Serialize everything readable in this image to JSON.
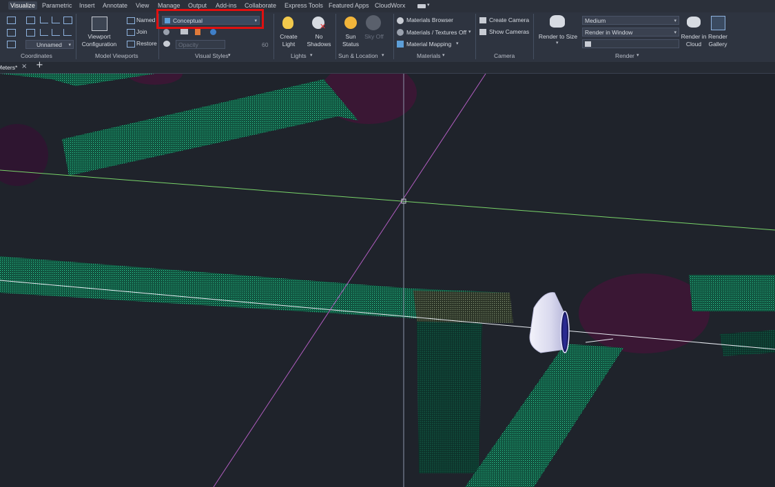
{
  "menu": {
    "tabs": [
      "Visualize",
      "Parametric",
      "Insert",
      "Annotate",
      "View",
      "Manage",
      "Output",
      "Add-ins",
      "Collaborate",
      "Express Tools",
      "Featured Apps",
      "CloudWorx"
    ],
    "active_index": 0
  },
  "ribbon": {
    "coordinates": {
      "ucs_name": "Unnamed",
      "panel_label": "Coordinates"
    },
    "model_viewports": {
      "viewport_config_line1": "Viewport",
      "viewport_config_line2": "Configuration",
      "named": "Named",
      "join": "Join",
      "restore": "Restore",
      "panel_label": "Model Viewports"
    },
    "visual_styles": {
      "current_style": "Conceptual",
      "opacity_placeholder": "Opacity",
      "opacity_value": "60",
      "panel_label": "Visual Styles"
    },
    "lights": {
      "create_light_line1": "Create",
      "create_light_line2": "Light",
      "no_shadows_line1": "No",
      "no_shadows_line2": "Shadows",
      "panel_label": "Lights"
    },
    "sun_location": {
      "sun_status_line1": "Sun",
      "sun_status_line2": "Status",
      "sky_off": "Sky Off",
      "panel_label": "Sun & Location"
    },
    "materials": {
      "materials_browser": "Materials Browser",
      "materials_textures": "Materials / Textures Off",
      "material_mapping": "Material Mapping",
      "panel_label": "Materials"
    },
    "camera": {
      "create_camera": "Create Camera",
      "show_cameras": "Show Cameras",
      "panel_label": "Camera"
    },
    "render": {
      "render_to_size": "Render to Size",
      "quality": "Medium",
      "render_target": "Render in Window",
      "render_cloud_line1": "Render in",
      "render_cloud_line2": "Cloud",
      "render_gallery_line1": "Render",
      "render_gallery_line2": "Gallery",
      "panel_label": "Render"
    }
  },
  "document_tabs": {
    "current": "Meters*",
    "close_glyph": "×",
    "new_glyph": "+"
  },
  "colors": {
    "highlight": "#e01010",
    "point_cloud": "#1fbf8a",
    "pipe_shadow": "#3a1734",
    "axis_x": "#7ad66a",
    "axis_y": "#b35ec2",
    "crosshair": "#8e97ad"
  }
}
